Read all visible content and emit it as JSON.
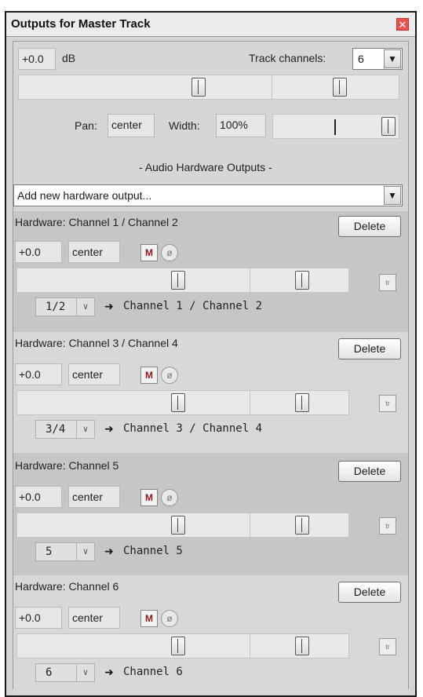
{
  "window": {
    "title": "Outputs for Master Track",
    "close_glyph": "✕"
  },
  "master": {
    "volume": "+0.0",
    "volume_unit": "dB",
    "track_channels_label": "Track channels:",
    "track_channels_value": "6",
    "pan_label": "Pan:",
    "pan_value": "center",
    "width_label": "Width:",
    "width_value": "100%"
  },
  "hardware_section": {
    "heading": "- Audio Hardware Outputs -",
    "add_output_placeholder": "Add new hardware output..."
  },
  "outputs": [
    {
      "label": "Hardware: Channel 1 / Channel 2",
      "delete_label": "Delete",
      "volume": "+0.0",
      "pan": "center",
      "mute_label": "M",
      "phase_icon": "ø",
      "channel_select": "1/2",
      "route_arrow": "➜",
      "destination": "Channel 1 / Channel 2",
      "tr_label": "tr"
    },
    {
      "label": "Hardware: Channel 3 / Channel 4",
      "delete_label": "Delete",
      "volume": "+0.0",
      "pan": "center",
      "mute_label": "M",
      "phase_icon": "ø",
      "channel_select": "3/4",
      "route_arrow": "➜",
      "destination": "Channel 3 / Channel 4",
      "tr_label": "tr"
    },
    {
      "label": "Hardware: Channel 5",
      "delete_label": "Delete",
      "volume": "+0.0",
      "pan": "center",
      "mute_label": "M",
      "phase_icon": "ø",
      "channel_select": "5",
      "route_arrow": "➜",
      "destination": "Channel 5",
      "tr_label": "tr"
    },
    {
      "label": "Hardware: Channel 6",
      "delete_label": "Delete",
      "volume": "+0.0",
      "pan": "center",
      "mute_label": "M",
      "phase_icon": "ø",
      "channel_select": "6",
      "route_arrow": "➜",
      "destination": "Channel 6",
      "tr_label": "tr"
    }
  ],
  "icons": {
    "dropdown": "chevron-down-icon",
    "close": "close-icon",
    "phase": "phase-invert-icon",
    "route": "arrow-right-icon"
  },
  "colors": {
    "close_button": "#e9514d",
    "mute_text": "#8b1b1b",
    "dark_row": "#c6c6c6",
    "light_row": "#d8d8d8"
  }
}
